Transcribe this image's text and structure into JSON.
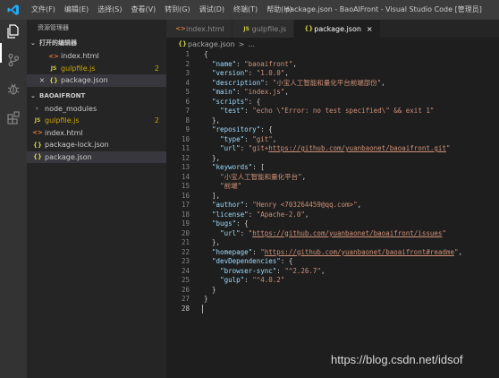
{
  "titlebar": {
    "menus": [
      "文件(F)",
      "编辑(E)",
      "选择(S)",
      "查看(V)",
      "转到(G)",
      "调试(D)",
      "终端(T)",
      "帮助(H)"
    ],
    "window_title": "package.json - BaoAIFront - Visual Studio Code [管理员]"
  },
  "activitybar": {
    "icons": [
      "explorer-icon",
      "source-control-icon",
      "debug-icon",
      "extensions-icon"
    ]
  },
  "sidebar": {
    "title": "资源管理器",
    "open_editors": {
      "label": "打开的编辑器",
      "items": [
        {
          "icon": "html",
          "label": "index.html",
          "badge": ""
        },
        {
          "icon": "js",
          "label": "gulpfile.js",
          "badge": "2"
        },
        {
          "icon": "json",
          "label": "package.json",
          "badge": ""
        }
      ]
    },
    "project": {
      "label": "BAOAIFRONT",
      "items": [
        {
          "icon": "folder",
          "label": "node_modules",
          "badge": ""
        },
        {
          "icon": "js",
          "label": "gulpfile.js",
          "badge": "2"
        },
        {
          "icon": "html",
          "label": "index.html",
          "badge": ""
        },
        {
          "icon": "json",
          "label": "package-lock.json",
          "badge": ""
        },
        {
          "icon": "json",
          "label": "package.json",
          "badge": ""
        }
      ]
    }
  },
  "tabs": [
    {
      "icon": "<>",
      "label": "index.html"
    },
    {
      "icon": "JS",
      "label": "gulpfile.js"
    },
    {
      "icon": "{}",
      "label": "package.json",
      "close": "×"
    }
  ],
  "breadcrumb": {
    "icon": "{}",
    "label": "package.json",
    "sep": ">",
    "more": "..."
  },
  "editor": {
    "lines": [
      [
        [
          "p",
          "{"
        ]
      ],
      [
        [
          "p",
          "  "
        ],
        [
          "k",
          "\"name\""
        ],
        [
          "p",
          ": "
        ],
        [
          "s",
          "\"baoaifront\""
        ],
        [
          "p",
          ","
        ]
      ],
      [
        [
          "p",
          "  "
        ],
        [
          "k",
          "\"version\""
        ],
        [
          "p",
          ": "
        ],
        [
          "s",
          "\"1.0.0\""
        ],
        [
          "p",
          ","
        ]
      ],
      [
        [
          "p",
          "  "
        ],
        [
          "k",
          "\"description\""
        ],
        [
          "p",
          ": "
        ],
        [
          "s",
          "\"小宝人工智能和量化平台前端部份\""
        ],
        [
          "p",
          ","
        ]
      ],
      [
        [
          "p",
          "  "
        ],
        [
          "k",
          "\"main\""
        ],
        [
          "p",
          ": "
        ],
        [
          "s",
          "\"index.js\""
        ],
        [
          "p",
          ","
        ]
      ],
      [
        [
          "p",
          "  "
        ],
        [
          "k",
          "\"scripts\""
        ],
        [
          "p",
          ": {"
        ]
      ],
      [
        [
          "p",
          "    "
        ],
        [
          "k",
          "\"test\""
        ],
        [
          "p",
          ": "
        ],
        [
          "s",
          "\"echo \\\"Error: no test specified\\\" && exit 1\""
        ]
      ],
      [
        [
          "p",
          "  },"
        ]
      ],
      [
        [
          "p",
          "  "
        ],
        [
          "k",
          "\"repository\""
        ],
        [
          "p",
          ": {"
        ]
      ],
      [
        [
          "p",
          "    "
        ],
        [
          "k",
          "\"type\""
        ],
        [
          "p",
          ": "
        ],
        [
          "s",
          "\"git\""
        ],
        [
          "p",
          ","
        ]
      ],
      [
        [
          "p",
          "    "
        ],
        [
          "k",
          "\"url\""
        ],
        [
          "p",
          ": "
        ],
        [
          "s",
          "\"git+"
        ],
        [
          "u",
          "https://github.com/yuanbaonet/baoaifront.git"
        ],
        [
          "s",
          "\""
        ]
      ],
      [
        [
          "p",
          "  },"
        ]
      ],
      [
        [
          "p",
          "  "
        ],
        [
          "k",
          "\"keywords\""
        ],
        [
          "p",
          ": ["
        ]
      ],
      [
        [
          "p",
          "    "
        ],
        [
          "s",
          "\"小宝人工智能和量化平台\""
        ],
        [
          "p",
          ","
        ]
      ],
      [
        [
          "p",
          "    "
        ],
        [
          "s",
          "\"前端\""
        ]
      ],
      [
        [
          "p",
          "  ],"
        ]
      ],
      [
        [
          "p",
          "  "
        ],
        [
          "k",
          "\"author\""
        ],
        [
          "p",
          ": "
        ],
        [
          "s",
          "\"Henry <703264459@qq.com>\""
        ],
        [
          "p",
          ","
        ]
      ],
      [
        [
          "p",
          "  "
        ],
        [
          "k",
          "\"license\""
        ],
        [
          "p",
          ": "
        ],
        [
          "s",
          "\"Apache-2.0\""
        ],
        [
          "p",
          ","
        ]
      ],
      [
        [
          "p",
          "  "
        ],
        [
          "k",
          "\"bugs\""
        ],
        [
          "p",
          ": {"
        ]
      ],
      [
        [
          "p",
          "    "
        ],
        [
          "k",
          "\"url\""
        ],
        [
          "p",
          ": "
        ],
        [
          "s",
          "\""
        ],
        [
          "u",
          "https://github.com/yuanbaonet/baoaifront/issues"
        ],
        [
          "s",
          "\""
        ]
      ],
      [
        [
          "p",
          "  },"
        ]
      ],
      [
        [
          "p",
          "  "
        ],
        [
          "k",
          "\"homepage\""
        ],
        [
          "p",
          ": "
        ],
        [
          "s",
          "\""
        ],
        [
          "u",
          "https://github.com/yuanbaonet/baoaifront#readme"
        ],
        [
          "s",
          "\""
        ],
        [
          "p",
          ","
        ]
      ],
      [
        [
          "p",
          "  "
        ],
        [
          "k",
          "\"devDependencies\""
        ],
        [
          "p",
          ": {"
        ]
      ],
      [
        [
          "p",
          "    "
        ],
        [
          "k",
          "\"browser-sync\""
        ],
        [
          "p",
          ": "
        ],
        [
          "s",
          "\"^2.26.7\""
        ],
        [
          "p",
          ","
        ]
      ],
      [
        [
          "p",
          "    "
        ],
        [
          "k",
          "\"gulp\""
        ],
        [
          "p",
          ": "
        ],
        [
          "s",
          "\"^4.0.2\""
        ]
      ],
      [
        [
          "p",
          "  }"
        ]
      ],
      [
        [
          "p",
          "}"
        ]
      ],
      [
        [
          "p",
          ""
        ]
      ]
    ]
  },
  "watermark": "https://blog.csdn.net/idsof"
}
